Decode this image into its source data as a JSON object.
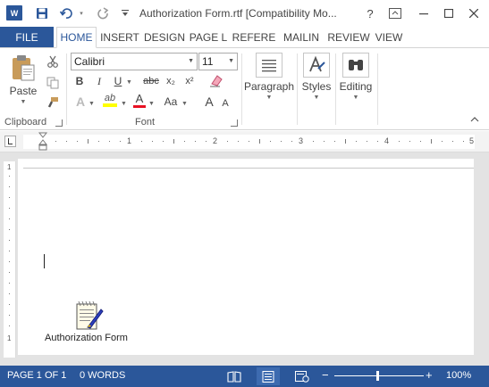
{
  "window": {
    "title": "Authorization Form.rtf [Compatibility Mo...",
    "app_logo": "W",
    "help_label": "?"
  },
  "tabs": {
    "file": "FILE",
    "items": [
      "HOME",
      "INSERT",
      "DESIGN",
      "PAGE L",
      "REFERE",
      "MAILIN",
      "REVIEW",
      "VIEW"
    ],
    "active": "HOME"
  },
  "ribbon": {
    "clipboard": {
      "label": "Clipboard",
      "paste_label": "Paste"
    },
    "font": {
      "label": "Font",
      "font_name": "Calibri",
      "font_size": "11",
      "bold": "B",
      "italic": "I",
      "underline": "U",
      "strikethrough": "abc",
      "subscript": "x₂",
      "superscript": "x²",
      "text_effects": "A",
      "highlight": "ab",
      "font_color": "A",
      "change_case": "Aa",
      "grow_font": "A",
      "shrink_font": "A"
    },
    "paragraph": {
      "label": "Paragraph"
    },
    "styles": {
      "label": "Styles"
    },
    "editing": {
      "label": "Editing"
    }
  },
  "ruler": {
    "numbers": [
      "1",
      "2",
      "3",
      "4",
      "5"
    ]
  },
  "document": {
    "embedded_object_label": "Authorization Form"
  },
  "statusbar": {
    "page": "PAGE 1 OF 1",
    "words": "0 WORDS",
    "zoom_minus": "−",
    "zoom_plus": "+",
    "zoom": "100%"
  },
  "colors": {
    "accent": "#2b579a",
    "highlight_yellow": "#ffff00",
    "font_red": "#e81123"
  }
}
